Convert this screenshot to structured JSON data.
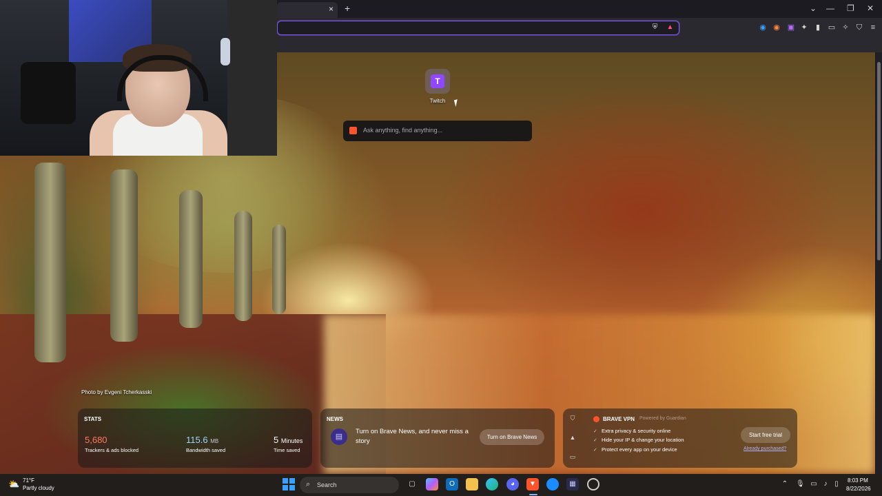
{
  "browser": {
    "tab_close": "×",
    "new_tab": "+",
    "url_placeholder": "",
    "window_controls": {
      "collapse": "⌄",
      "minimize": "—",
      "restore": "❐",
      "close": "✕"
    }
  },
  "new_tab_page": {
    "top_site": {
      "label": "Twitch",
      "glyph": "T"
    },
    "search_placeholder": "Ask anything, find anything...",
    "photo_credit": "Photo by Evgeni Tcherkasski"
  },
  "stats": {
    "title": "STATS",
    "trackers": {
      "value": "5,680",
      "label": "Trackers & ads blocked",
      "color": "#ff7a59"
    },
    "bandwidth": {
      "value": "115.6",
      "unit": "MB",
      "label": "Bandwidth saved",
      "color": "#9fd3ff"
    },
    "time": {
      "value": "5",
      "unit": "Minutes",
      "label": "Time saved"
    }
  },
  "news": {
    "title": "NEWS",
    "text": "Turn on Brave News, and never miss a story",
    "button": "Turn on Brave News"
  },
  "vpn": {
    "title": "BRAVE VPN",
    "powered_by": "Powered by Guardian",
    "features": [
      "Extra privacy & security online",
      "Hide your IP & change your location",
      "Protect every app on your device"
    ],
    "button": "Start free trial",
    "link": "Already purchased?"
  },
  "taskbar": {
    "weather": {
      "temp": "71°F",
      "condition": "Partly cloudy"
    },
    "search_label": "Search",
    "clock": {
      "time": "8:03 PM",
      "date": "8/22/2026"
    }
  },
  "colors": {
    "accent": "#7a5cf0",
    "brave": "#fb542b",
    "twitch": "#9146ff"
  }
}
